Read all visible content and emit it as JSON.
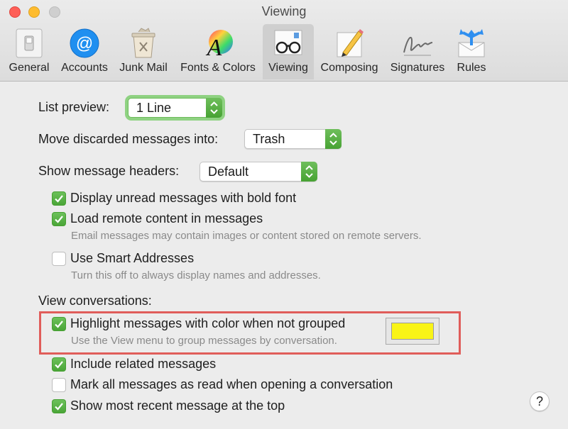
{
  "window": {
    "title": "Viewing"
  },
  "toolbar": {
    "tabs": [
      {
        "label": "General",
        "icon": "light-switch-icon"
      },
      {
        "label": "Accounts",
        "icon": "at-sign-icon"
      },
      {
        "label": "Junk Mail",
        "icon": "junk-mail-bin-icon"
      },
      {
        "label": "Fonts & Colors",
        "icon": "font-color-wheel-icon"
      },
      {
        "label": "Viewing",
        "icon": "glasses-envelope-icon",
        "selected": true
      },
      {
        "label": "Composing",
        "icon": "pencil-paper-icon"
      },
      {
        "label": "Signatures",
        "icon": "signature-icon"
      },
      {
        "label": "Rules",
        "icon": "rules-envelope-icon"
      }
    ]
  },
  "settings": {
    "list_preview": {
      "label": "List preview:",
      "value": "1 Line"
    },
    "move_discarded": {
      "label": "Move discarded messages into:",
      "value": "Trash"
    },
    "show_headers": {
      "label": "Show message headers:",
      "value": "Default"
    },
    "display_unread_bold": {
      "label": "Display unread messages with bold font",
      "checked": true
    },
    "load_remote": {
      "label": "Load remote content in messages",
      "hint": "Email messages may contain images or content stored on remote servers.",
      "checked": true
    },
    "smart_addresses": {
      "label": "Use Smart Addresses",
      "hint": "Turn this off to always display names and addresses.",
      "checked": false
    },
    "conversations_heading": "View conversations:",
    "highlight_color": {
      "label": "Highlight messages with color when not grouped",
      "hint": "Use the View menu to group messages by conversation.",
      "checked": true,
      "color": "#f9f416"
    },
    "include_related": {
      "label": "Include related messages",
      "checked": true
    },
    "mark_all_read": {
      "label": "Mark all messages as read when opening a conversation",
      "checked": false
    },
    "most_recent_top": {
      "label": "Show most recent message at the top",
      "checked": true
    }
  },
  "help": {
    "label": "?"
  },
  "colors": {
    "accent": "#4aa537",
    "highlight_outline": "#e05d5a"
  }
}
